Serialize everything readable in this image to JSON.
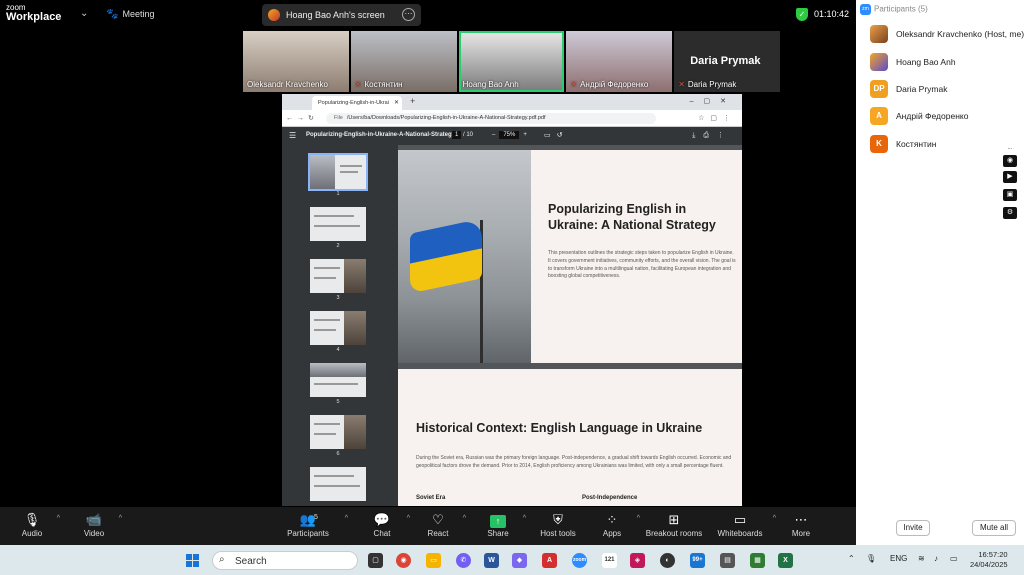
{
  "app": {
    "logo_line1": "zoom",
    "logo_line2": "Workplace",
    "meeting_label": "Meeting",
    "timer": "01:10:42"
  },
  "screen_share": {
    "label": "Hoang Bao Anh's screen"
  },
  "video_tiles": [
    {
      "name": "Oleksandr Kravchenko",
      "muted": false
    },
    {
      "name": "Костянтин",
      "muted": true
    },
    {
      "name": "Hoang Bao Anh",
      "muted": false
    },
    {
      "name": "Андрій Федоренко",
      "muted": true
    },
    {
      "name": "Daria Prymak",
      "muted": true,
      "display_name": "Daria Prymak"
    }
  ],
  "browser": {
    "tab_title": "Popularizing-English-in-Ukrai",
    "url_label": "File",
    "url": "/Users/ba/Downloads/Popularizing-English-in-Ukraine-A-National-Strategy.pdf.pdf"
  },
  "pdf": {
    "filename": "Popularizing-English-in-Ukraine-A-National-Strategy",
    "current_page": "1",
    "total_pages": "/ 10",
    "zoom": "75%",
    "thumb_numbers": [
      "1",
      "2",
      "3",
      "4",
      "5",
      "6"
    ],
    "page1": {
      "title": "Popularizing English in Ukraine: A National Strategy",
      "body": "This presentation outlines the strategic steps taken to popularize English in Ukraine. It covers government initiatives, community efforts, and the overall vision. The goal is to transform Ukraine into a multilingual nation, facilitating European integration and boosting global competitiveness."
    },
    "page2": {
      "title": "Historical Context: English Language in Ukraine",
      "body": "During the Soviet era, Russian was the primary foreign language. Post-independence, a gradual shift towards English occurred. Economic and geopolitical factors drove the demand. Prior to 2014, English proficiency among Ukrainians was limited, with only a small percentage fluent.",
      "col1": "Soviet Era",
      "col2": "Post-Independence"
    }
  },
  "participants_panel": {
    "title": "Participants (5)",
    "people": [
      {
        "name": "Oleksandr Kravchenko (Host, me)",
        "initials": "",
        "color": "#c0703a"
      },
      {
        "name": "Hoang Bao Anh",
        "initials": "",
        "color": "#6a5acd"
      },
      {
        "name": "Daria Prymak",
        "initials": "DP",
        "color": "#f0a020"
      },
      {
        "name": "Андрій Федоренко",
        "initials": "A",
        "color": "#f5a623"
      },
      {
        "name": "Костянтин",
        "initials": "K",
        "color": "#e8650a"
      }
    ],
    "invite_label": "Invite",
    "mute_all_label": "Mute all"
  },
  "toolbar": {
    "audio": "Audio",
    "video": "Video",
    "participants": "Participants",
    "participants_count": "5",
    "chat": "Chat",
    "react": "React",
    "share": "Share",
    "host_tools": "Host tools",
    "apps": "Apps",
    "breakout": "Breakout rooms",
    "whiteboards": "Whiteboards",
    "more": "More"
  },
  "taskbar": {
    "search_placeholder": "Search",
    "badge": "99+",
    "calendar_day": "121",
    "lang": "ENG",
    "time": "16:57:20",
    "date": "24/04/2025"
  },
  "colors": {
    "accent": "#2d8cff",
    "share_green": "#27c267",
    "active_tile": "#2ecc71"
  }
}
